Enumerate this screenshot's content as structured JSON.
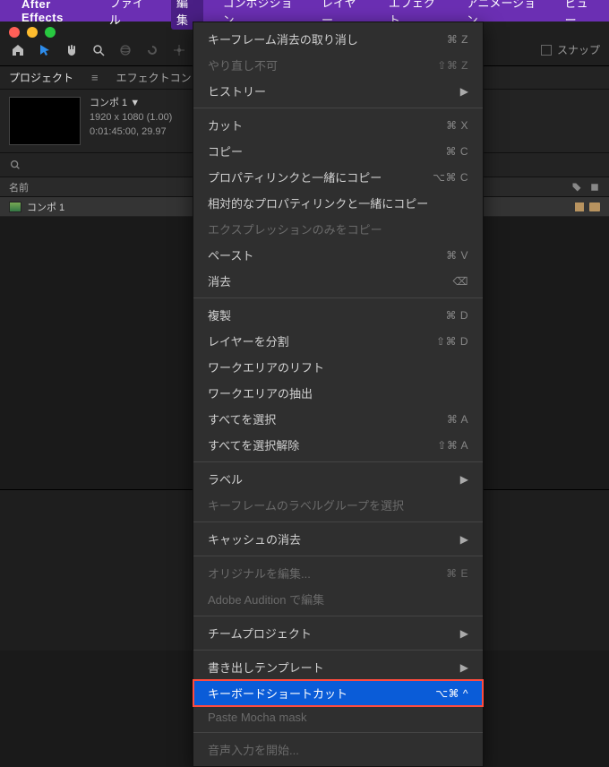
{
  "menubar": {
    "app_name": "After Effects",
    "items": [
      "ファイル",
      "編集",
      "コンポジション",
      "レイヤー",
      "エフェクト",
      "アニメーション",
      "ビュー"
    ],
    "active_index": 1
  },
  "toolbar": {
    "snap_label": "スナップ"
  },
  "panels": {
    "project_tab": "プロジェクト",
    "effects_tab": "エフェクトコン"
  },
  "composition": {
    "name": "コンポ 1",
    "dims": "1920 x 1080 (1.00)",
    "duration": "0:01:45:00, 29.97"
  },
  "list": {
    "header_name": "名前",
    "item_name": "コンポ 1"
  },
  "dropdown": {
    "groups": [
      [
        {
          "label": "キーフレーム消去の取り消し",
          "shortcut": "⌘ Z",
          "disabled": false
        },
        {
          "label": "やり直し不可",
          "shortcut": "⇧⌘ Z",
          "disabled": true
        },
        {
          "label": "ヒストリー",
          "sub": "▶",
          "disabled": false
        }
      ],
      [
        {
          "label": "カット",
          "shortcut": "⌘ X",
          "disabled": false
        },
        {
          "label": "コピー",
          "shortcut": "⌘ C",
          "disabled": false
        },
        {
          "label": "プロパティリンクと一緒にコピー",
          "shortcut": "⌥⌘ C",
          "disabled": false
        },
        {
          "label": "相対的なプロパティリンクと一緒にコピー",
          "disabled": false
        },
        {
          "label": "エクスプレッションのみをコピー",
          "disabled": true
        },
        {
          "label": "ペースト",
          "shortcut": "⌘ V",
          "disabled": false
        },
        {
          "label": "消去",
          "shortcut": "⌫",
          "disabled": false
        }
      ],
      [
        {
          "label": "複製",
          "shortcut": "⌘ D",
          "disabled": false
        },
        {
          "label": "レイヤーを分割",
          "shortcut": "⇧⌘ D",
          "disabled": false
        },
        {
          "label": "ワークエリアのリフト",
          "disabled": false
        },
        {
          "label": "ワークエリアの抽出",
          "disabled": false
        },
        {
          "label": "すべてを選択",
          "shortcut": "⌘ A",
          "disabled": false
        },
        {
          "label": "すべてを選択解除",
          "shortcut": "⇧⌘ A",
          "disabled": false
        }
      ],
      [
        {
          "label": "ラベル",
          "sub": "▶",
          "disabled": false
        },
        {
          "label": "キーフレームのラベルグループを選択",
          "disabled": true
        }
      ],
      [
        {
          "label": "キャッシュの消去",
          "sub": "▶",
          "disabled": false
        }
      ],
      [
        {
          "label": "オリジナルを編集...",
          "shortcut": "⌘ E",
          "disabled": true
        },
        {
          "label": "Adobe Audition で編集",
          "disabled": true
        }
      ],
      [
        {
          "label": "チームプロジェクト",
          "sub": "▶",
          "disabled": false
        }
      ],
      [
        {
          "label": "書き出しテンプレート",
          "sub": "▶",
          "disabled": false
        },
        {
          "label": "キーボードショートカット",
          "shortcut": "⌥⌘ ^",
          "disabled": false,
          "highlighted": true
        },
        {
          "label": "Paste Mocha mask",
          "disabled": true
        }
      ],
      [
        {
          "label": "音声入力を開始...",
          "disabled": true
        }
      ]
    ]
  }
}
